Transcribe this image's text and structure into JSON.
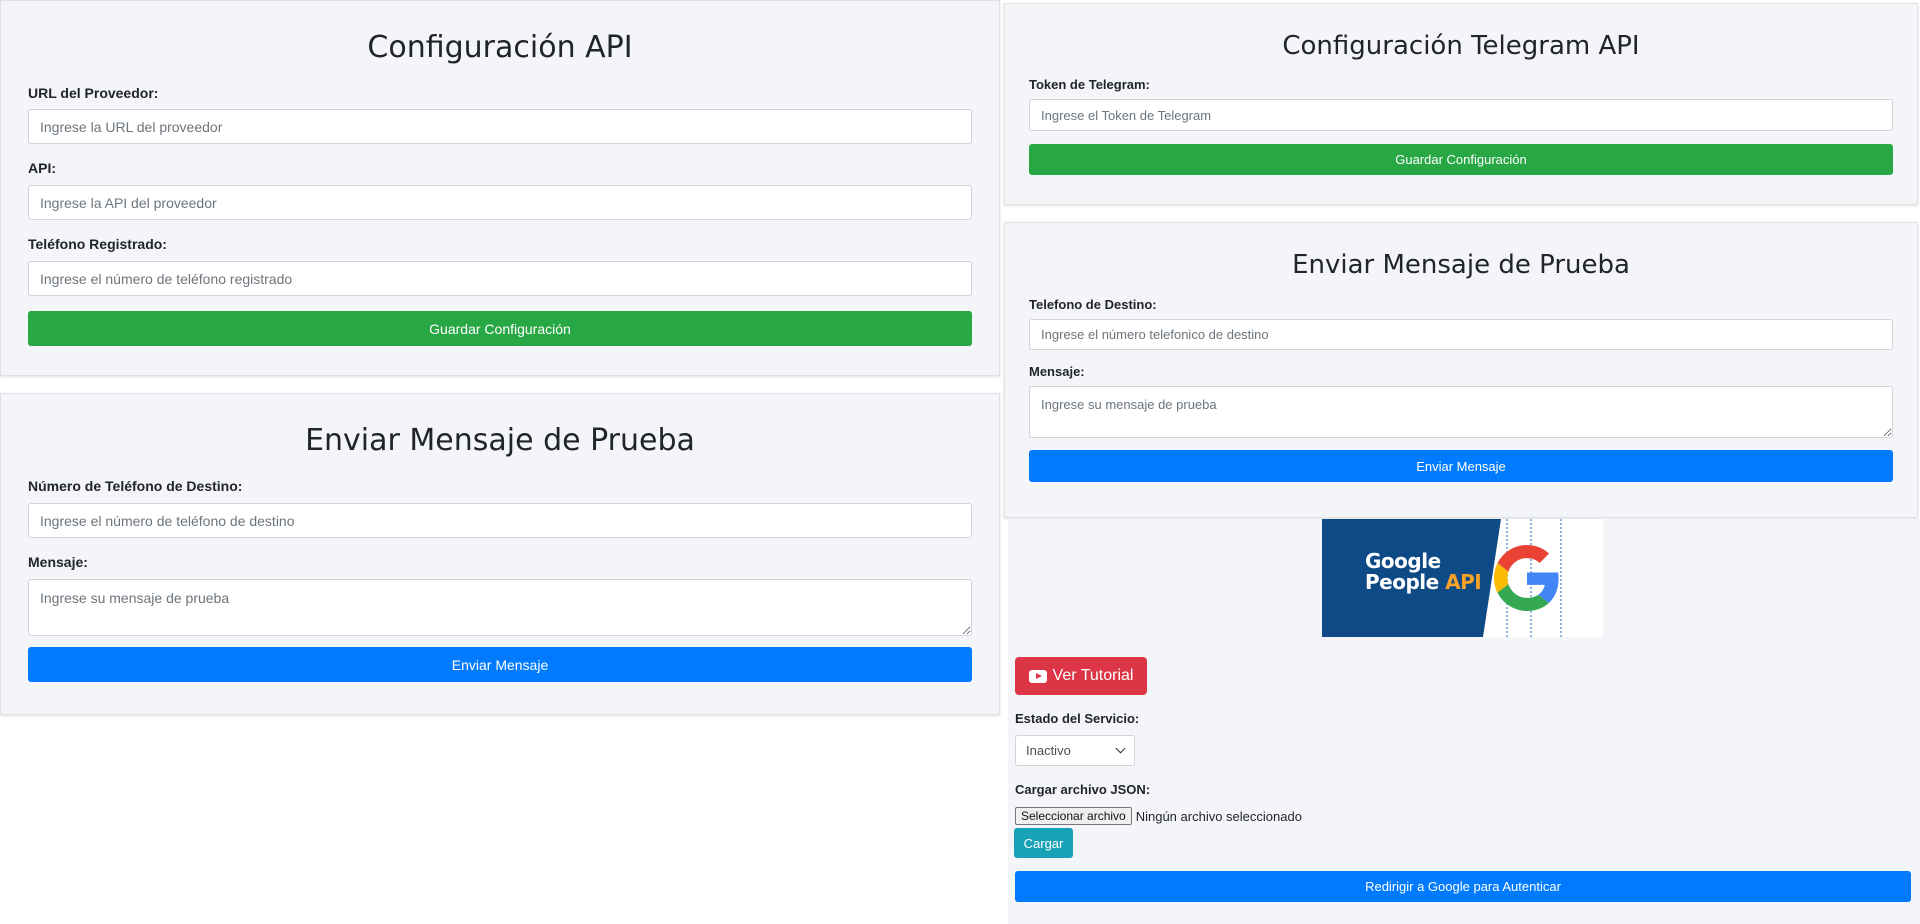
{
  "api_config": {
    "title": "Configuración API",
    "provider_url_label": "URL del Proveedor:",
    "provider_url_placeholder": "Ingrese la URL del proveedor",
    "api_label": "API:",
    "api_placeholder": "Ingrese la API del proveedor",
    "phone_label": "Teléfono Registrado:",
    "phone_placeholder": "Ingrese el número de teléfono registrado",
    "save_label": "Guardar Configuración"
  },
  "test_message_left": {
    "title": "Enviar Mensaje de Prueba",
    "phone_label": "Número de Teléfono de Destino:",
    "phone_placeholder": "Ingrese el número de teléfono de destino",
    "message_label": "Mensaje:",
    "message_placeholder": "Ingrese su mensaje de prueba",
    "send_label": "Enviar Mensaje"
  },
  "telegram_config": {
    "title": "Configuración Telegram API",
    "token_label": "Token de Telegram:",
    "token_placeholder": "Ingrese el Token de Telegram",
    "save_label": "Guardar Configuración"
  },
  "test_message_right": {
    "title": "Enviar Mensaje de Prueba",
    "phone_label": "Telefono de Destino:",
    "phone_placeholder": "Ingrese el número telefonico de destino",
    "message_label": "Mensaje:",
    "message_placeholder": "Ingrese su mensaje de prueba",
    "send_label": "Enviar Mensaje"
  },
  "google": {
    "banner_line1": "Google",
    "banner_line2": "People",
    "banner_api": "API",
    "tutorial_label": "Ver Tutorial",
    "status_label": "Estado del Servicio:",
    "status_value": "Inactivo",
    "json_label": "Cargar archivo JSON:",
    "file_button": "Seleccionar archivo",
    "file_status": "Ningún archivo seleccionado",
    "upload_label": "Cargar",
    "auth_label": "Redirigir a Google para Autenticar"
  },
  "colors": {
    "green": "#28a745",
    "blue": "#007bff",
    "red": "#dc3545",
    "teal": "#17a2b8",
    "banner_blue": "#0d4a86"
  }
}
